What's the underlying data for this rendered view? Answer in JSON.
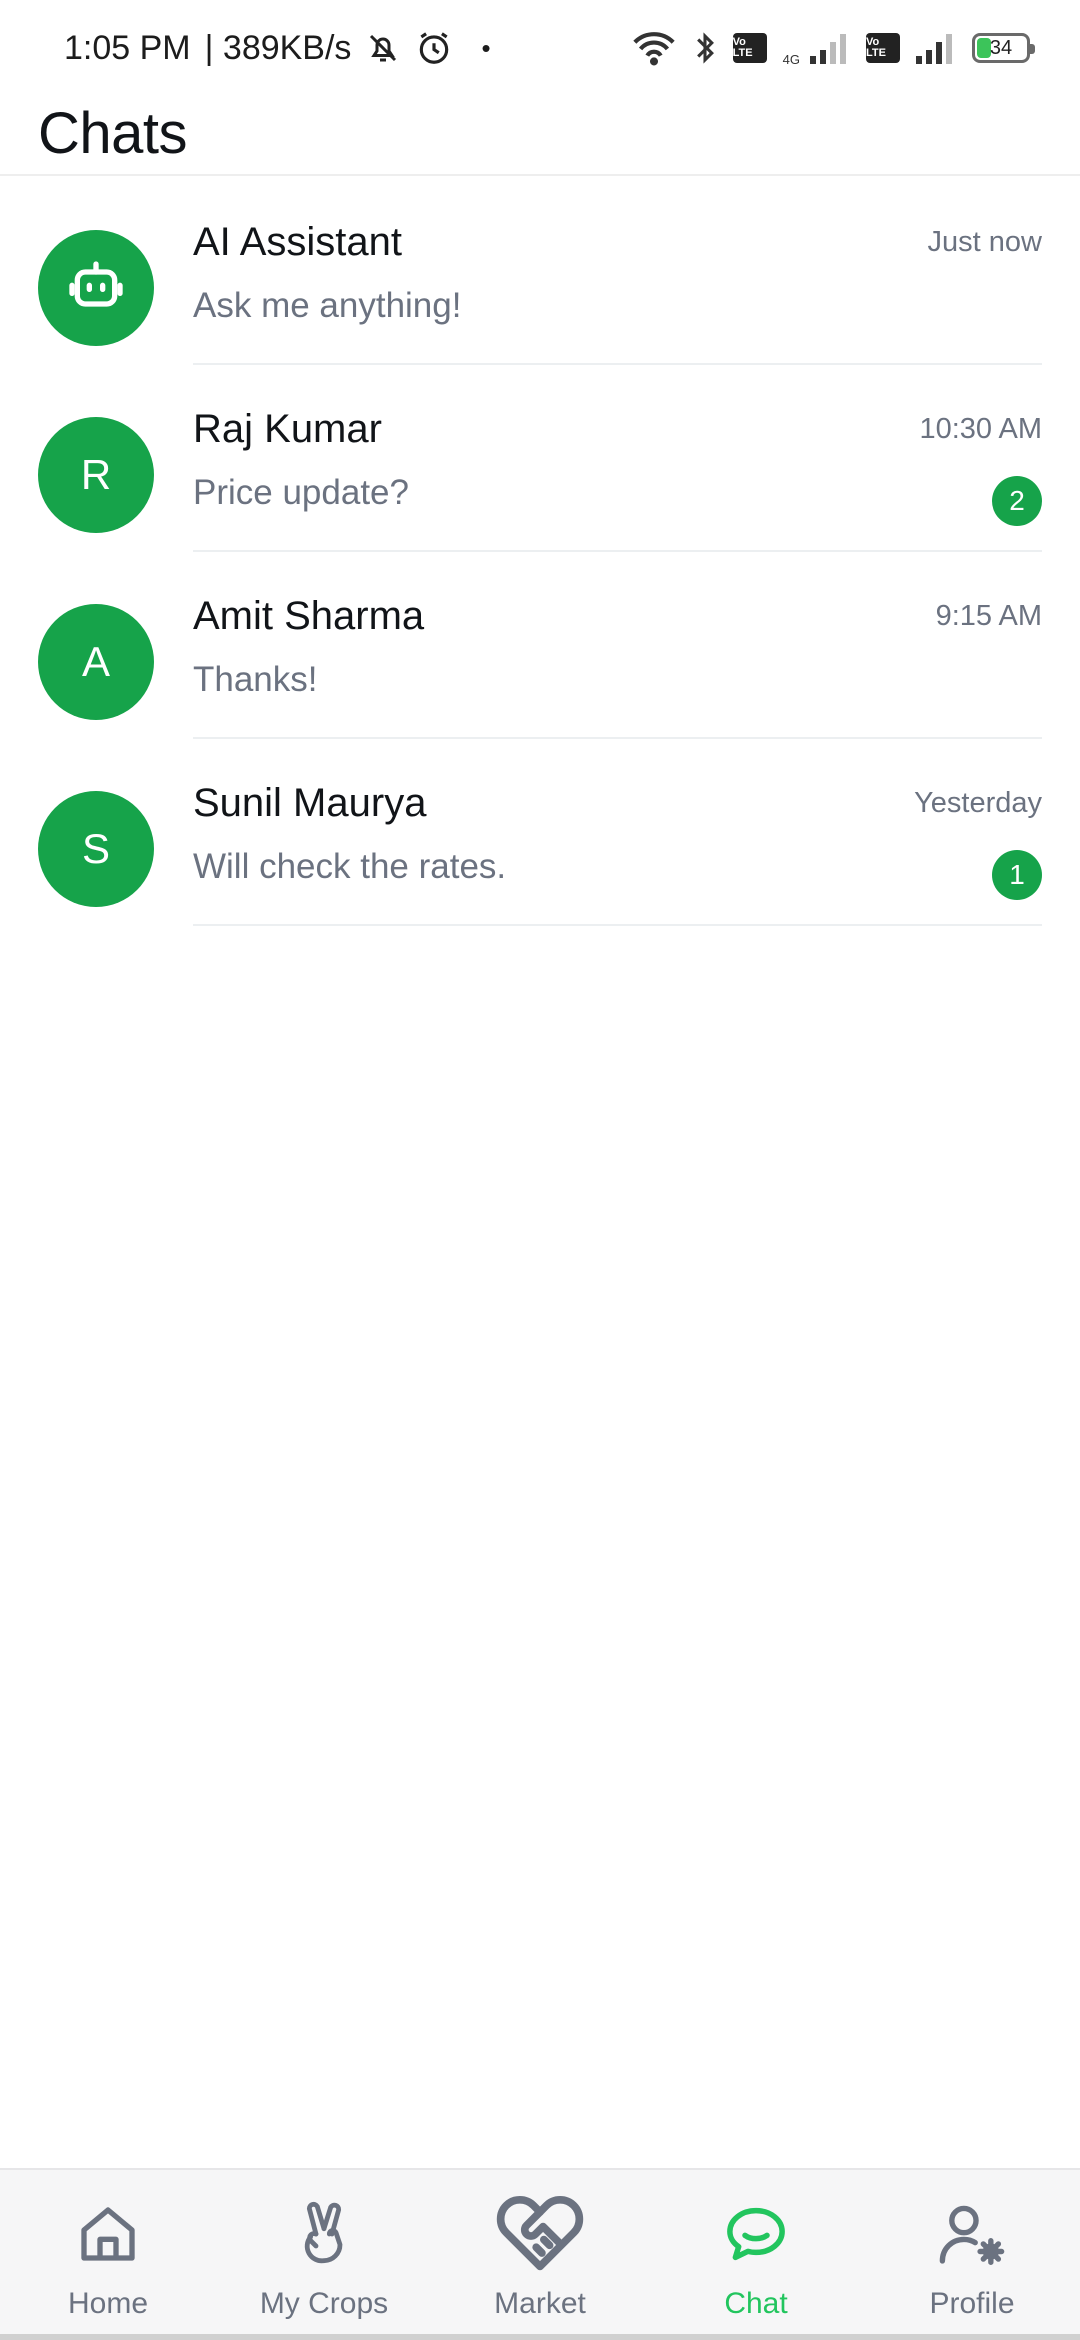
{
  "status_bar": {
    "time": "1:05 PM",
    "net_speed": "| 389KB/s",
    "dot": "•",
    "network_type": "4G",
    "volte_1": "Vo LTE",
    "volte_2": "Vo LTE",
    "battery_level": "34",
    "icons": [
      "muted-bell-icon",
      "alarm-icon",
      "wifi-icon",
      "bluetooth-icon",
      "signal-icon",
      "battery-icon"
    ]
  },
  "header": {
    "title": "Chats"
  },
  "chats": [
    {
      "avatar": "",
      "avatar_icon": "robot-icon",
      "name": "AI Assistant",
      "time": "Just now",
      "preview": "Ask me anything!",
      "unread": ""
    },
    {
      "avatar": "R",
      "name": "Raj Kumar",
      "time": "10:30 AM",
      "preview": "Price update?",
      "unread": "2"
    },
    {
      "avatar": "A",
      "name": "Amit Sharma",
      "time": "9:15 AM",
      "preview": "Thanks!",
      "unread": ""
    },
    {
      "avatar": "S",
      "name": "Sunil Maurya",
      "time": "Yesterday",
      "preview": "Will check the rates.",
      "unread": "1"
    }
  ],
  "bottom_nav": {
    "items": [
      {
        "label": "Home",
        "icon": "home-icon"
      },
      {
        "label": "My Crops",
        "icon": "peace-hand-icon"
      },
      {
        "label": "Market",
        "icon": "handshake-heart-icon"
      },
      {
        "label": "Chat",
        "icon": "chat-bubble-icon",
        "active": true
      },
      {
        "label": "Profile",
        "icon": "user-settings-icon"
      }
    ]
  },
  "colors": {
    "accent": "#16a34a",
    "active_nav": "#22c55e",
    "text_primary": "#111418",
    "text_secondary": "#6b7280"
  }
}
